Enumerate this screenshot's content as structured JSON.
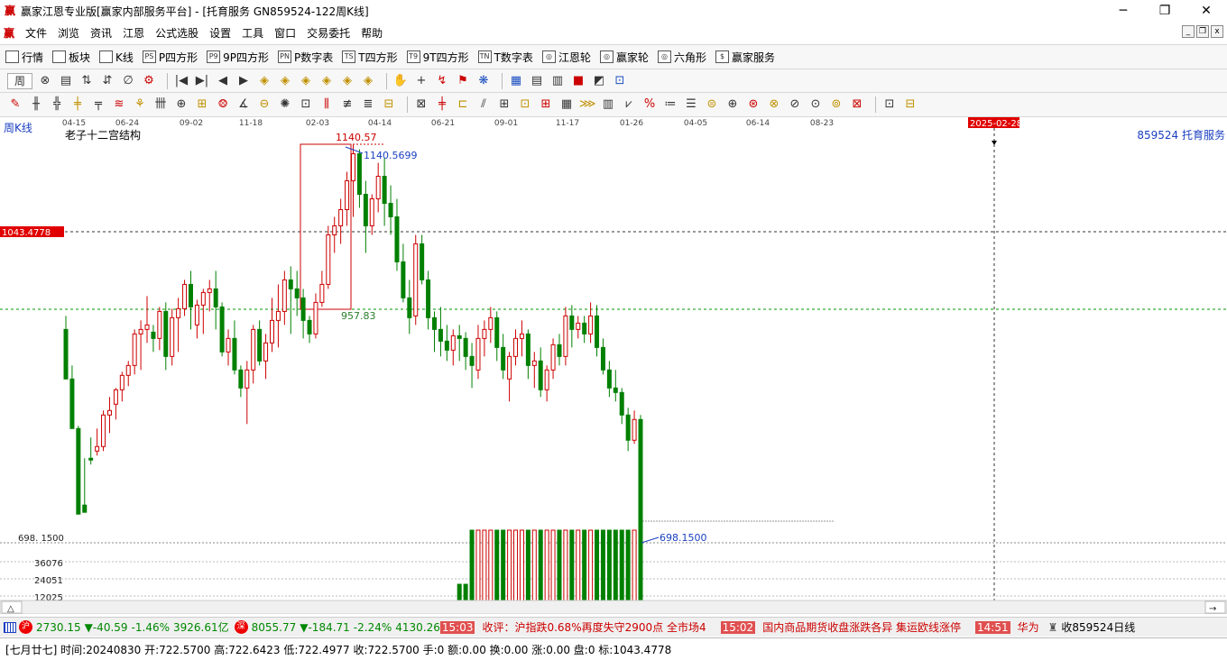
{
  "window": {
    "title": "赢家江恩专业版[赢家内部服务平台] - [托育服务   GN859524-122周K线]",
    "logo_glyph": "赢",
    "controls": [
      "─",
      "❐",
      "✕"
    ]
  },
  "menu": {
    "items": [
      "文件",
      "浏览",
      "资讯",
      "江恩",
      "公式选股",
      "设置",
      "工具",
      "窗口",
      "交易委托",
      "帮助"
    ],
    "mdi_controls": [
      "_",
      "❐",
      "x"
    ]
  },
  "toolbar1": {
    "items": [
      {
        "label": "行情",
        "icon": "grid-icon"
      },
      {
        "label": "板块",
        "icon": "blocks-icon"
      },
      {
        "label": "K线",
        "icon": "candle-icon"
      },
      {
        "label": "P四方形",
        "icon": "ps-icon",
        "glyph": "PS"
      },
      {
        "label": "9P四方形",
        "icon": "p9-icon",
        "glyph": "P9"
      },
      {
        "label": "P数字表",
        "icon": "pn-icon",
        "glyph": "PN"
      },
      {
        "label": "T四方形",
        "icon": "ts-icon",
        "glyph": "TS"
      },
      {
        "label": "9T四方形",
        "icon": "t9-icon",
        "glyph": "T9"
      },
      {
        "label": "T数字表",
        "icon": "tn-icon",
        "glyph": "TN"
      },
      {
        "label": "江恩轮",
        "icon": "wheel-icon",
        "glyph": "◎"
      },
      {
        "label": "赢家轮",
        "icon": "wheel2-icon",
        "glyph": "◎"
      },
      {
        "label": "六角形",
        "icon": "hexagon-icon",
        "glyph": "◎"
      },
      {
        "label": "赢家服务",
        "icon": "dollar-icon",
        "glyph": "$"
      }
    ]
  },
  "toolbar2": {
    "period_label": "周",
    "icons": [
      "⊗",
      "▤",
      "⇅",
      "⇵",
      "∅",
      "⚙",
      "|◀",
      "▶|",
      "◀",
      "▶",
      "◈",
      "◈",
      "◈",
      "◈",
      "◈",
      "◈",
      "✋",
      "+",
      "↯",
      "⚑",
      "❋",
      "▦",
      "▤",
      "▥",
      "■",
      "◩",
      "⊡"
    ]
  },
  "toolbar3": {
    "icons": [
      "✎",
      "╫",
      "╬",
      "╪",
      "╤",
      "≋",
      "⚘",
      "卌",
      "⊕",
      "⊞",
      "⨷",
      "∡",
      "⊖",
      "✺",
      "⊡",
      "⫼",
      "≢",
      "≣",
      "⊟",
      "⊠",
      "╪",
      "⊏",
      "⫽",
      "⊞",
      "⊡",
      "⊞",
      "▦",
      "⋙",
      "▥",
      "⩗",
      "%",
      "≔",
      "☰",
      "⊜",
      "⊕",
      "⊛",
      "⊗",
      "⊘",
      "⊙",
      "⊚",
      "⊠",
      "⊡",
      "⊟"
    ]
  },
  "chart": {
    "period_label": "周K线",
    "structure_label": "老子十二宫结构",
    "code_name": "859524  托育服务",
    "x_ticks": [
      "04-15",
      "06-24",
      "09-02",
      "11-18",
      "02-03",
      "04-14",
      "06-21",
      "09-01",
      "11-17",
      "01-26",
      "04-05",
      "06-14",
      "08-23"
    ],
    "cursor_date": "2025-02-28",
    "cursor_price": "1043.4778",
    "box_high": "1140.57",
    "box_low": "957.83",
    "annot_high": "1140.5699",
    "annot_low": "698.1500",
    "axis_price": "698. 1500",
    "vol_ticks": [
      "36076",
      "24051",
      "12025"
    ],
    "scroll_left": "△",
    "scroll_right": "→"
  },
  "chart_data": {
    "type": "candlestick",
    "title": "老子十二宫结构",
    "series_name": "859524  托育服务",
    "x_ticks": [
      "04-15",
      "06-24",
      "09-02",
      "11-18",
      "02-03",
      "04-14",
      "06-21",
      "09-01",
      "11-17",
      "01-26",
      "04-05",
      "06-14",
      "08-23"
    ],
    "highlighted_price_levels": [
      1043.4778,
      957.83,
      698.15
    ],
    "box": {
      "high": 1140.57,
      "low": 957.83
    },
    "ylim": [
      698.15,
      1150
    ],
    "vol_ticks": [
      36076,
      24051,
      12025
    ],
    "candles_ohlc": [
      [
        935,
        950,
        885,
        880
      ],
      [
        880,
        895,
        830,
        825
      ],
      [
        825,
        828,
        740,
        730
      ],
      [
        740,
        792,
        735,
        732
      ],
      [
        792,
        815,
        785,
        790
      ],
      [
        800,
        825,
        795,
        805
      ],
      [
        805,
        845,
        800,
        840
      ],
      [
        840,
        860,
        820,
        845
      ],
      [
        852,
        870,
        835,
        868
      ],
      [
        868,
        888,
        855,
        884
      ],
      [
        884,
        900,
        872,
        895
      ],
      [
        895,
        935,
        885,
        930
      ],
      [
        930,
        945,
        890,
        935
      ],
      [
        935,
        972,
        920,
        940
      ],
      [
        932,
        940,
        910,
        925
      ],
      [
        925,
        960,
        912,
        955
      ],
      [
        955,
        965,
        890,
        905
      ],
      [
        905,
        958,
        895,
        948
      ],
      [
        948,
        970,
        910,
        958
      ],
      [
        958,
        990,
        950,
        985
      ],
      [
        985,
        1000,
        935,
        960
      ],
      [
        940,
        968,
        925,
        962
      ],
      [
        962,
        980,
        930,
        976
      ],
      [
        976,
        990,
        955,
        980
      ],
      [
        980,
        1000,
        935,
        960
      ],
      [
        960,
        965,
        905,
        910
      ],
      [
        910,
        935,
        895,
        925
      ],
      [
        925,
        945,
        885,
        890
      ],
      [
        890,
        895,
        860,
        870
      ],
      [
        870,
        900,
        830,
        890
      ],
      [
        890,
        940,
        875,
        935
      ],
      [
        935,
        945,
        895,
        900
      ],
      [
        900,
        930,
        880,
        920
      ],
      [
        920,
        970,
        910,
        945
      ],
      [
        945,
        985,
        915,
        955
      ],
      [
        955,
        1000,
        940,
        990
      ],
      [
        990,
        1005,
        930,
        980
      ],
      [
        980,
        1000,
        950,
        970
      ],
      [
        970,
        980,
        925,
        945
      ],
      [
        945,
        950,
        920,
        930
      ],
      [
        930,
        975,
        925,
        965
      ],
      [
        965,
        1000,
        960,
        985
      ],
      [
        985,
        1050,
        980,
        1040
      ],
      [
        1040,
        1060,
        1020,
        1050
      ],
      [
        1050,
        1080,
        1030,
        1068
      ],
      [
        1068,
        1110,
        1050,
        1100
      ],
      [
        1100,
        1140,
        1060,
        1130
      ],
      [
        1130,
        1135,
        1070,
        1085
      ],
      [
        1085,
        1100,
        1020,
        1050
      ],
      [
        1050,
        1085,
        1040,
        1080
      ],
      [
        1080,
        1120,
        1065,
        1105
      ],
      [
        1105,
        1125,
        1050,
        1075
      ],
      [
        1075,
        1095,
        1040,
        1060
      ],
      [
        1060,
        1080,
        1000,
        1010
      ],
      [
        1010,
        1030,
        965,
        970
      ],
      [
        970,
        990,
        930,
        948
      ],
      [
        950,
        1040,
        940,
        1030
      ],
      [
        1030,
        1040,
        985,
        990
      ],
      [
        990,
        1000,
        935,
        948
      ],
      [
        948,
        955,
        910,
        935
      ],
      [
        935,
        960,
        905,
        922
      ],
      [
        922,
        940,
        900,
        912
      ],
      [
        912,
        935,
        895,
        928
      ],
      [
        928,
        940,
        900,
        925
      ],
      [
        925,
        932,
        890,
        905
      ],
      [
        905,
        920,
        870,
        895
      ],
      [
        890,
        940,
        880,
        925
      ],
      [
        925,
        945,
        905,
        935
      ],
      [
        935,
        960,
        920,
        948
      ],
      [
        948,
        955,
        900,
        915
      ],
      [
        915,
        930,
        880,
        890
      ],
      [
        880,
        910,
        855,
        905
      ],
      [
        905,
        935,
        895,
        925
      ],
      [
        925,
        945,
        905,
        930
      ],
      [
        930,
        935,
        880,
        895
      ],
      [
        895,
        910,
        870,
        900
      ],
      [
        900,
        915,
        860,
        868
      ],
      [
        868,
        895,
        855,
        890
      ],
      [
        890,
        925,
        880,
        918
      ],
      [
        918,
        930,
        895,
        905
      ],
      [
        905,
        960,
        895,
        950
      ],
      [
        950,
        962,
        915,
        935
      ],
      [
        935,
        950,
        925,
        942
      ],
      [
        942,
        950,
        920,
        930
      ],
      [
        930,
        965,
        920,
        950
      ],
      [
        950,
        962,
        905,
        915
      ],
      [
        915,
        925,
        885,
        890
      ],
      [
        890,
        900,
        860,
        870
      ],
      [
        870,
        890,
        855,
        865
      ],
      [
        865,
        870,
        830,
        840
      ],
      [
        840,
        848,
        800,
        812
      ],
      [
        812,
        845,
        808,
        835
      ],
      [
        835,
        840,
        698.15,
        705
      ]
    ]
  },
  "status": {
    "sh_badge": "沪",
    "sh_index": "2730.15",
    "sh_change": "▼-40.59",
    "sh_pct": "-1.46%",
    "sh_amount": "3926.61亿",
    "sz_badge": "深",
    "sz_index": "8055.77",
    "sz_change": "▼-184.71",
    "sz_pct": "-2.24%",
    "sz_amount": "4130.26",
    "news_time1": "15:03",
    "news_text1": "收评：沪指跌0.68%再度失守2900点 全市场4",
    "news_time2": "15:02",
    "news_text2": "国内商品期货收盘涨跌各异 集运欧线涨停",
    "news_time3": "14:51",
    "news_text3": "华为",
    "right_text": "收859524日线"
  },
  "info": {
    "text": "[七月廿七] 时间:20240830 开:722.5700 高:722.6423 低:722.4977 收:722.5700 手:0 额:0.00 换:0.00 涨:0.00 盘:0 标:1043.4778"
  },
  "colors": {
    "up": "#cc0000",
    "down": "#008000",
    "cursor_badge": "#e00000"
  }
}
